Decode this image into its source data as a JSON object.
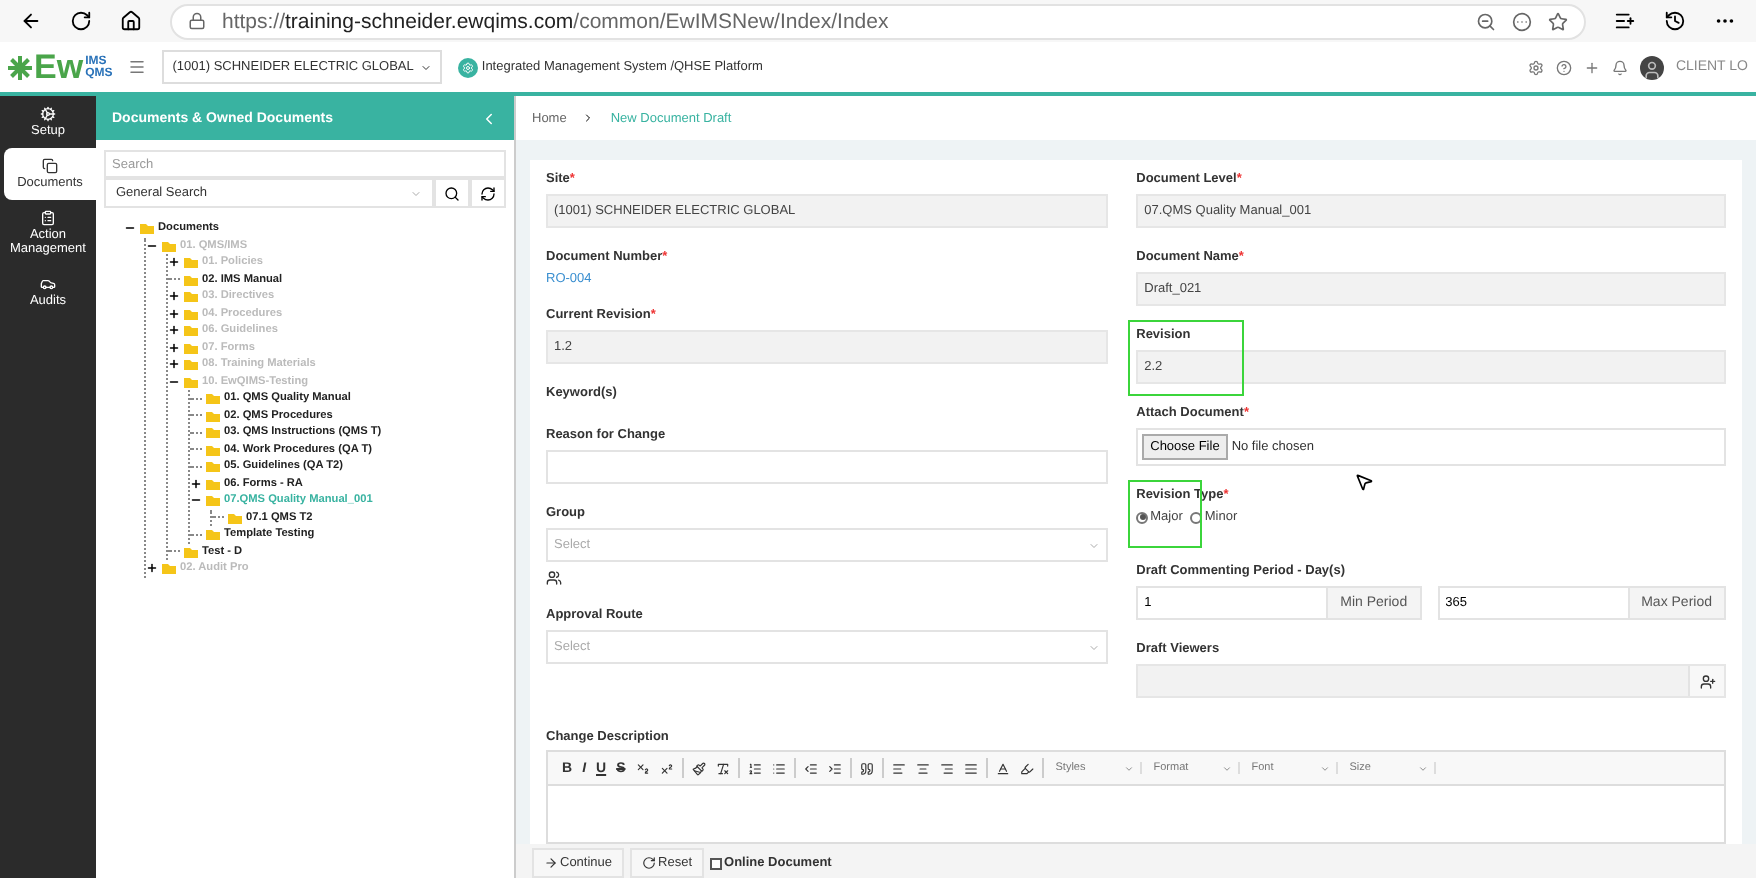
{
  "browser": {
    "url_prefix": "https://",
    "url_host": "training-schneider.ewqims.com",
    "url_path": "/common/EwIMSNew/Index/Index"
  },
  "header": {
    "logo": {
      "main": "Ew",
      "top": "IMS",
      "bottom": "QMS"
    },
    "site_select": "(1001) SCHNEIDER ELECTRIC GLOBAL",
    "platform": "Integrated Management System /QHSE Platform",
    "user": "CLIENT LO"
  },
  "nav": [
    {
      "label": "Setup",
      "selected": false
    },
    {
      "label": "Documents",
      "selected": true
    },
    {
      "label": "Action Management",
      "selected": false
    },
    {
      "label": "Audits",
      "selected": false
    }
  ],
  "panel": {
    "title": "Documents & Owned Documents",
    "search": {
      "placeholder": "Search"
    },
    "search_type": "General Search",
    "tree": [
      {
        "label": "Documents",
        "kind": "folder",
        "expanded": true,
        "muted": false,
        "selected": false,
        "children": [
          {
            "label": "01. QMS/IMS",
            "kind": "folder",
            "expanded": true,
            "muted": true,
            "selected": false,
            "children": [
              {
                "label": "01. Policies",
                "kind": "folder",
                "expanded": false,
                "muted": true,
                "selected": false
              },
              {
                "label": "02. IMS Manual",
                "kind": "leaf",
                "muted": false,
                "selected": false
              },
              {
                "label": "03. Directives",
                "kind": "folder",
                "expanded": false,
                "muted": true,
                "selected": false
              },
              {
                "label": "04. Procedures",
                "kind": "folder",
                "expanded": false,
                "muted": true,
                "selected": false
              },
              {
                "label": "06. Guidelines",
                "kind": "folder",
                "expanded": false,
                "muted": true,
                "selected": false
              },
              {
                "label": "07. Forms",
                "kind": "folder",
                "expanded": false,
                "muted": true,
                "selected": false
              },
              {
                "label": "08. Training Materials",
                "kind": "folder",
                "expanded": false,
                "muted": true,
                "selected": false
              },
              {
                "label": "10. EwQIMS-Testing",
                "kind": "folder",
                "expanded": true,
                "muted": true,
                "selected": false,
                "children": [
                  {
                    "label": "01. QMS Quality Manual",
                    "kind": "leaf",
                    "muted": false,
                    "selected": false
                  },
                  {
                    "label": "02. QMS Procedures",
                    "kind": "leaf",
                    "muted": false,
                    "selected": false
                  },
                  {
                    "label": "03. QMS Instructions (QMS T)",
                    "kind": "leaf",
                    "muted": false,
                    "selected": false
                  },
                  {
                    "label": "04. Work Procedures (QA T)",
                    "kind": "leaf",
                    "muted": false,
                    "selected": false
                  },
                  {
                    "label": "05. Guidelines (QA T2)",
                    "kind": "leaf",
                    "muted": false,
                    "selected": false
                  },
                  {
                    "label": "06. Forms - RA",
                    "kind": "folder",
                    "expanded": false,
                    "muted": false,
                    "selected": false
                  },
                  {
                    "label": "07.QMS Quality Manual_001",
                    "kind": "folder",
                    "expanded": true,
                    "muted": false,
                    "selected": true,
                    "children": [
                      {
                        "label": "07.1 QMS T2",
                        "kind": "leaf",
                        "muted": false,
                        "selected": false
                      }
                    ]
                  },
                  {
                    "label": "Template Testing",
                    "kind": "leaf",
                    "muted": false,
                    "selected": false
                  }
                ]
              },
              {
                "label": "Test - D",
                "kind": "leaf",
                "muted": false,
                "selected": false
              }
            ]
          },
          {
            "label": "02. Audit Pro",
            "kind": "folder",
            "expanded": false,
            "muted": true,
            "selected": false
          }
        ]
      }
    ]
  },
  "breadcrumb": [
    "Home",
    "New Document Draft"
  ],
  "form": {
    "left": [
      {
        "kind": "readonly",
        "label": "Site",
        "mark": "*",
        "value": "(1001) SCHNEIDER ELECTRIC GLOBAL",
        "highlighted": false
      },
      {
        "kind": "link",
        "label": "Document Number",
        "mark": "*",
        "value": "RO-004",
        "highlighted": false
      },
      {
        "kind": "readonly",
        "label": "Current Revision",
        "mark": "*",
        "value": "1.2",
        "highlighted": false
      },
      {
        "kind": "label",
        "label": "Keyword(s)",
        "highlighted": false
      },
      {
        "kind": "input",
        "label": "Reason for Change",
        "highlighted": false
      },
      {
        "kind": "select",
        "label": "Group",
        "placeholder": "Select",
        "group_icon": true,
        "highlighted": false
      },
      {
        "kind": "select",
        "label": "Approval Route",
        "placeholder": "Select",
        "highlighted": false
      }
    ],
    "right": [
      {
        "kind": "readonly",
        "label": "Document Level",
        "mark": "*",
        "value": "07.QMS Quality Manual_001",
        "highlighted": false
      },
      {
        "kind": "readonly",
        "label": "Document Name",
        "mark": "*",
        "value": "Draft_021",
        "highlighted": false
      },
      {
        "kind": "readonly",
        "label": "Revision",
        "value": "2.2",
        "highlighted": true
      },
      {
        "kind": "file",
        "label": "Attach Document",
        "mark": "*",
        "button": "Choose File",
        "status": "No file chosen",
        "highlighted": false
      },
      {
        "kind": "radio",
        "label": "Revision Type",
        "mark": "*",
        "highlighted": true,
        "options": [
          {
            "label": "Major",
            "selected": true
          },
          {
            "label": "Minor",
            "selected": false
          }
        ]
      },
      {
        "kind": "period",
        "label": "Draft Commenting Period - Day(s)",
        "highlighted": false,
        "inputs": [
          {
            "value": "1",
            "addon": "Min Period"
          },
          {
            "value": "365",
            "addon": "Max Period"
          }
        ]
      },
      {
        "kind": "viewers",
        "label": "Draft Viewers",
        "highlighted": false
      }
    ]
  },
  "editor": {
    "label": "Change Description",
    "format_buttons": [
      "B",
      "I",
      "U",
      "S"
    ],
    "dropdowns": [
      "Styles",
      "Format",
      "Font",
      "Size"
    ]
  },
  "footer": {
    "continue": "Continue",
    "reset": "Reset",
    "online": {
      "label": "Online Document",
      "checked": false
    }
  }
}
